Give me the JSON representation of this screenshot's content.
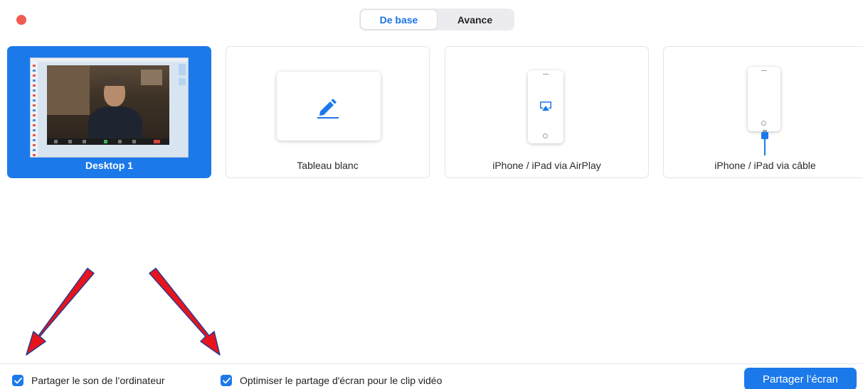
{
  "window": {
    "close_color": "#ee5c52"
  },
  "tabs": [
    {
      "label": "De base",
      "active": true
    },
    {
      "label": "Avance",
      "active": false
    }
  ],
  "share_options": [
    {
      "label": "Desktop 1",
      "selected": true,
      "icon": "desktop-thumbnail"
    },
    {
      "label": "Tableau blanc",
      "selected": false,
      "icon": "pencil-icon"
    },
    {
      "label": "iPhone / iPad via AirPlay",
      "selected": false,
      "icon": "airplay-icon"
    },
    {
      "label": "iPhone / iPad via câble",
      "selected": false,
      "icon": "cable-icon"
    }
  ],
  "footer": {
    "share_sound_label": "Partager le son de l’ordinateur",
    "share_sound_checked": true,
    "optimize_video_label": "Optimiser le partage d'écran pour le clip vidéo",
    "optimize_video_checked": true,
    "share_button_label": "Partager l’écran"
  },
  "colors": {
    "accent": "#1c79ea",
    "annotation_arrow": "#e8141c"
  }
}
